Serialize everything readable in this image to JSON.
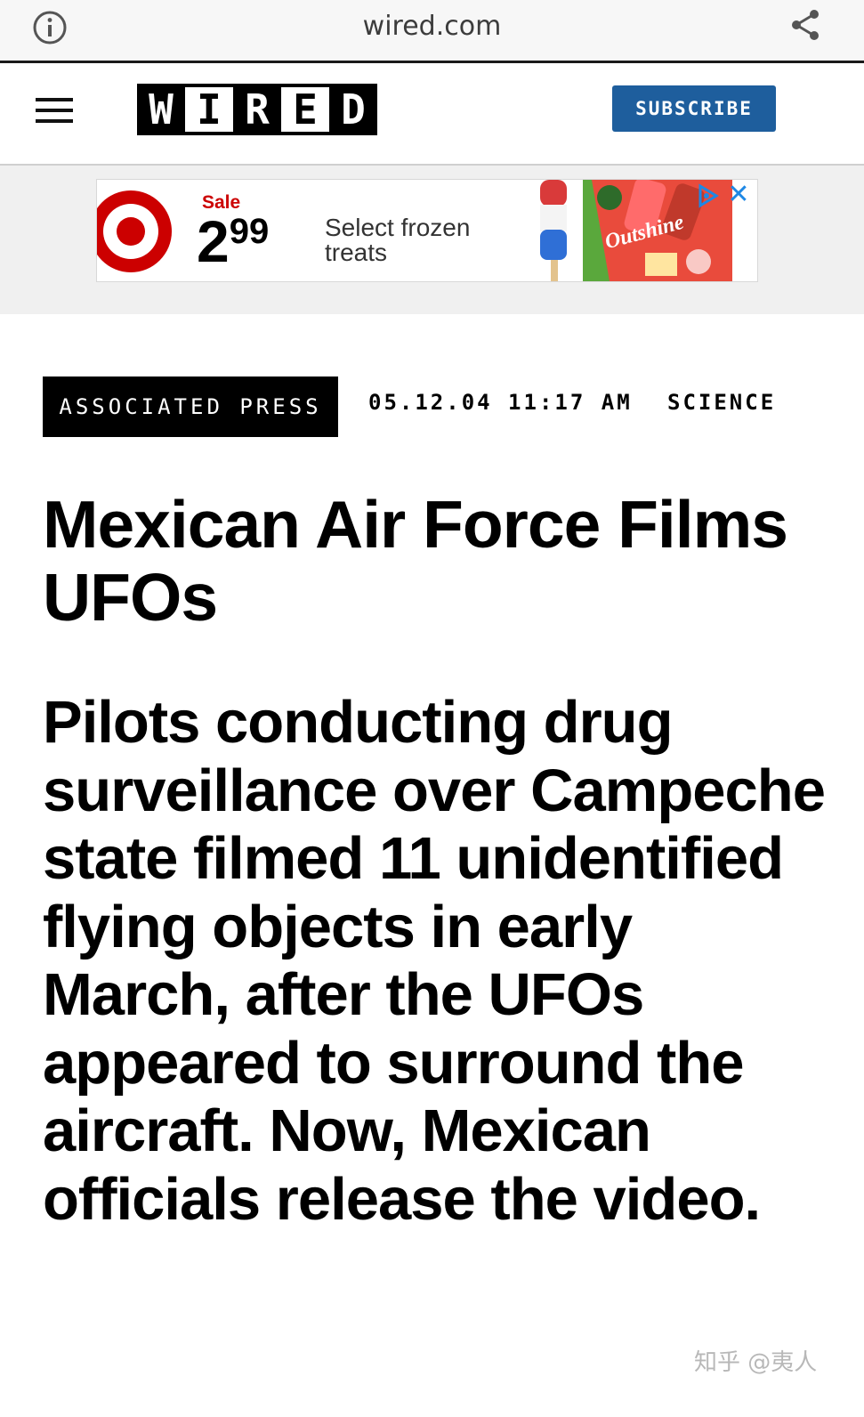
{
  "browser": {
    "url": "wired.com",
    "info_icon": "info-icon",
    "share_icon": "share-icon"
  },
  "header": {
    "menu_icon": "hamburger-menu-icon",
    "logo_letters": [
      "W",
      "I",
      "R",
      "E",
      "D"
    ],
    "subscribe_label": "SUBSCRIBE",
    "subscribe_color": "#1e5e9d"
  },
  "ad": {
    "sale_label": "Sale",
    "price_dollars": "2",
    "price_cents": "99",
    "text_line1": "Select frozen",
    "text_line2": "treats",
    "brand": "Outshine",
    "adchoices_icon": "adchoices-icon",
    "close_label": "✕",
    "sale_color": "#cc0000"
  },
  "article": {
    "source": "ASSOCIATED PRESS",
    "date": "05.12.04 11:17 AM",
    "section": "SCIENCE",
    "headline": "Mexican Air Force Films UFOs",
    "dek": "Pilots conducting drug surveillance over Campeche state filmed 11 unidentified flying objects in early March, after the UFOs appeared to surround the aircraft. Now, Mexican officials release the video."
  },
  "watermark": "知乎 @夷人"
}
